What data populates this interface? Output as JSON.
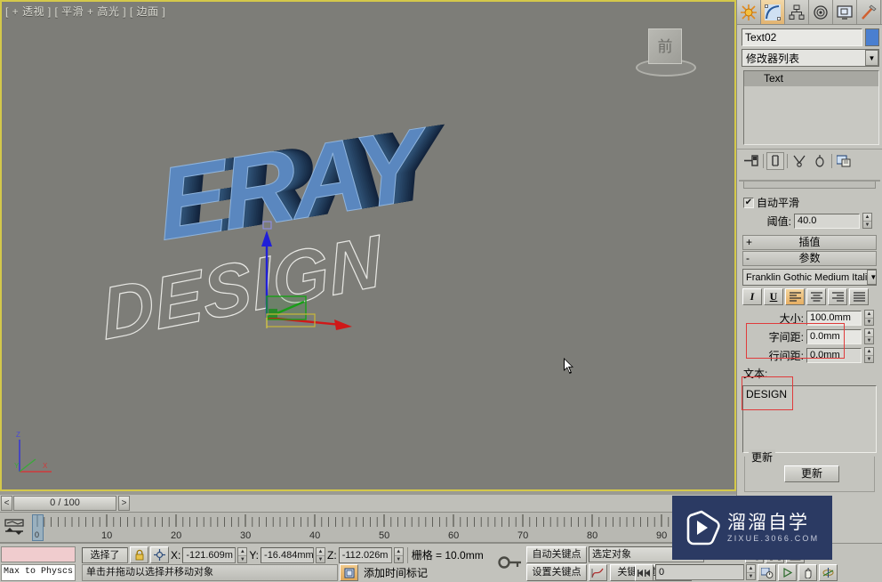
{
  "viewport": {
    "label": "[ + 透视 ] [ 平滑 + 高光 ] [ 边面 ]",
    "viewcube_face": "前",
    "scene": {
      "solid_text": "ERAY",
      "wireframe_text": "DESIGN"
    },
    "axis_tripod": {
      "z": "Z",
      "y": "Y",
      "x": "X"
    }
  },
  "timeline": {
    "prev_label": "<",
    "next_label": ">",
    "frame_field": "0 / 100",
    "current_frame": "0",
    "ticks": [
      "10",
      "20",
      "30",
      "40",
      "50",
      "60",
      "70",
      "80",
      "90"
    ]
  },
  "maxscript": {
    "input_value": "",
    "listener_text": "Max to Physcs ("
  },
  "status": {
    "selection_label": "选择了",
    "lock_icon": "lock-icon",
    "coord_center_icon": "coordinate-center-icon",
    "x_label": "X:",
    "x_value": "-121.609m",
    "y_label": "Y:",
    "y_value": "-16.484mm",
    "z_label": "Z:",
    "z_value": "-112.026m",
    "grid_label": "栅格 = 10.0mm",
    "prompt": "单击并拖动以选择并移动对象",
    "add_time_tag": "添加时间标记"
  },
  "animation": {
    "key_icon": "key-icon",
    "auto_key": "自动关键点",
    "set_key": "设置关键点",
    "selection_set": "选定对象",
    "curve_icon": "curve-editor-icon",
    "key_filters": "关键点过滤器...",
    "frame_input": "0",
    "frame_nav_icon": "go-to-start-end-icon"
  },
  "navigation": {
    "icons": [
      "time-config-icon",
      "play-icon",
      "zoom-all-icon",
      "zoom-extents-icon",
      "pan-hand-icon",
      "orbit-icon"
    ]
  },
  "command_panel": {
    "tabs": [
      {
        "name": "create-tab",
        "icon": "star-icon",
        "active": false
      },
      {
        "name": "modify-tab",
        "icon": "curve-icon",
        "active": true
      },
      {
        "name": "hierarchy-tab",
        "icon": "hierarchy-icon",
        "active": false
      },
      {
        "name": "motion-tab",
        "icon": "target-icon",
        "active": false
      },
      {
        "name": "display-tab",
        "icon": "monitor-icon",
        "active": false
      },
      {
        "name": "utilities-tab",
        "icon": "hammer-icon",
        "active": false
      }
    ],
    "object_name": "Text02",
    "modifier_list_label": "修改器列表",
    "modifier_list_caret": "▼",
    "stack": [
      {
        "label": "Text"
      }
    ],
    "stack_tools": [
      "pin-stack-icon",
      "show-end-result-icon",
      "make-unique-icon",
      "remove-modifier-icon",
      "configure-sets-icon"
    ],
    "rollouts": {
      "auto_smooth": {
        "checkbox_label": "自动平滑",
        "checked": "✔",
        "threshold_label": "阈值:",
        "threshold_value": "40.0"
      },
      "interpolation": {
        "sign": "+",
        "title": "插值"
      },
      "parameters": {
        "sign": "-",
        "title": "参数"
      },
      "font": {
        "family": "Franklin Gothic Medium Itali",
        "caret": "▼",
        "style_buttons": [
          {
            "name": "italic-button",
            "glyph": "I",
            "active": false
          },
          {
            "name": "underline-button",
            "glyph": "U",
            "active": false
          },
          {
            "name": "align-left-button",
            "glyph": "≡",
            "active": true
          },
          {
            "name": "align-center-button",
            "glyph": "≡",
            "active": false
          },
          {
            "name": "align-right-button",
            "glyph": "≡",
            "active": false
          },
          {
            "name": "align-justify-button",
            "glyph": "≡",
            "active": false
          }
        ],
        "size_label": "大小:",
        "size_value": "100.0mm",
        "kerning_label": "字间距:",
        "kerning_value": "0.0mm",
        "leading_label": "行间距:",
        "leading_value": "0.0mm",
        "text_label": "文本:",
        "text_value": "DESIGN"
      },
      "update": {
        "title": "更新",
        "button_label": "更新"
      }
    }
  },
  "watermark": {
    "title": "溜溜自学",
    "subtitle": "ZIXUE.3066.COM",
    "logo_icon": "play-triangle-icon",
    "bg_color": "#2b3a63"
  },
  "colors": {
    "viewport_bg": "#7d7d78",
    "viewport_border": "#d4c84a",
    "panel_bg": "#c4c4be",
    "text_solid": "#5a87bf",
    "text_extrude": "#22405e",
    "accent_orange": "#e2b471",
    "annotation_red": "#e03b3b"
  }
}
